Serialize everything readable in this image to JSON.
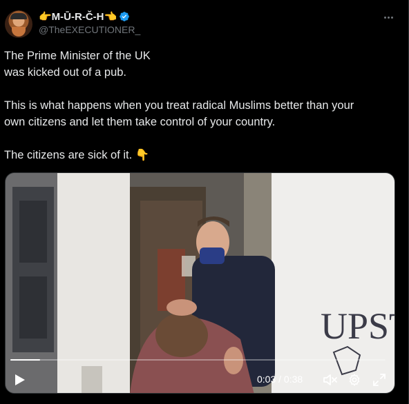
{
  "post": {
    "author": {
      "display_name": "👉M-Ū-R-Č-H👈",
      "handle": "@TheEXECUTIONER_",
      "verified": true
    },
    "more_icon": "more-horizontal-icon",
    "text": {
      "line1": "The Prime Minister of the UK",
      "line2": "was kicked out of a pub.",
      "line3": "This is what happens when you treat radical Muslims better than your",
      "line4": "own citizens and let them take control of your country.",
      "line5": "The citizens are sick of it. 👇"
    },
    "video": {
      "sign_text": "UPST",
      "progress": 0.079,
      "current_time": "0:03",
      "duration": "0:38",
      "time_separator": " / ",
      "controls": [
        "play-icon",
        "mute-icon",
        "settings-gear-icon",
        "fullscreen-icon"
      ]
    }
  },
  "colors": {
    "background": "#000000",
    "text": "#e7e9ea",
    "secondary_text": "#71767b",
    "verified_blue": "#1d9bf0",
    "divider": "#2f3336"
  }
}
